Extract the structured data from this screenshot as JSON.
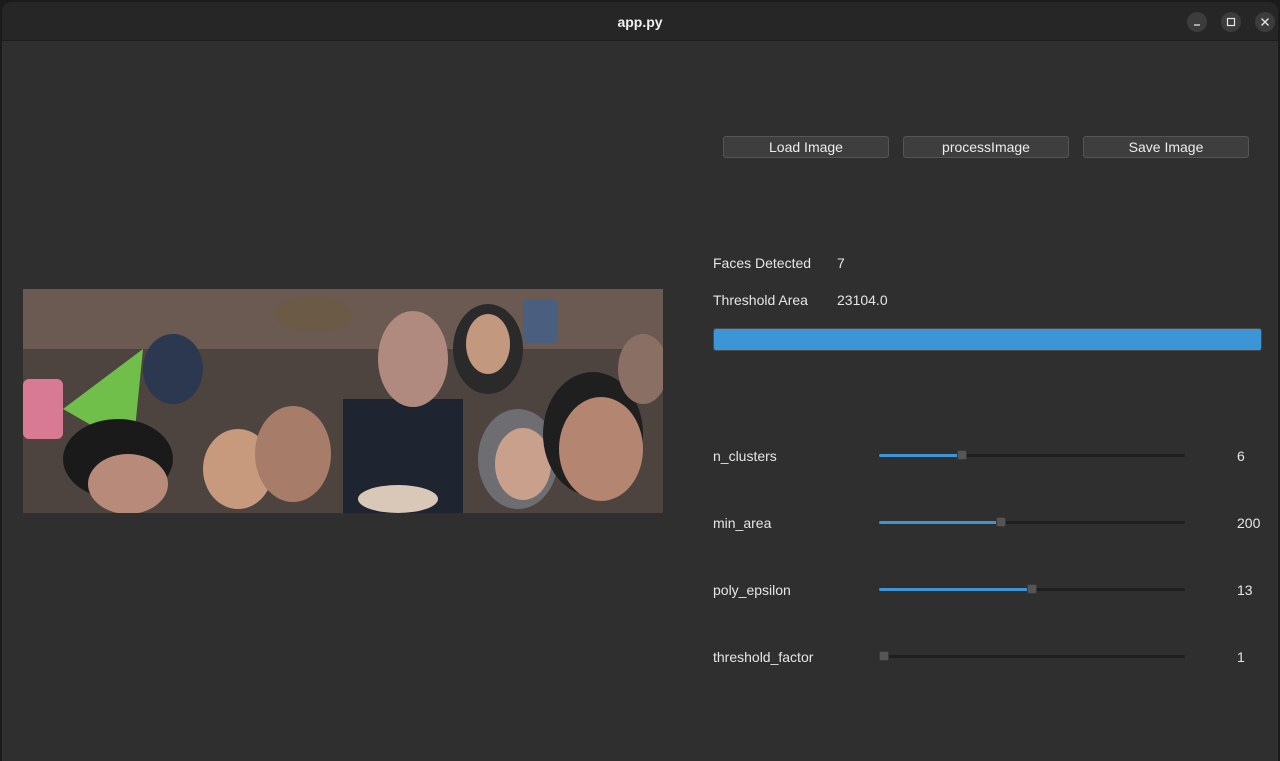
{
  "window": {
    "title": "app.py"
  },
  "toolbar": {
    "load_label": "Load Image",
    "process_label": "processImage",
    "save_label": "Save Image"
  },
  "stats": {
    "faces_label": "Faces Detected",
    "faces_value": "7",
    "threshold_label": "Threshold Area",
    "threshold_value": "23104.0"
  },
  "progress": {
    "percent": 100
  },
  "sliders": [
    {
      "name": "n_clusters",
      "value": "6",
      "position": 0.27
    },
    {
      "name": "min_area",
      "value": "200",
      "position": 0.4
    },
    {
      "name": "poly_epsilon",
      "value": "13",
      "position": 0.5
    },
    {
      "name": "threshold_factor",
      "value": "1",
      "position": 0.0
    }
  ],
  "colors": {
    "accent": "#3b95d6",
    "background": "#2f2f2f"
  }
}
